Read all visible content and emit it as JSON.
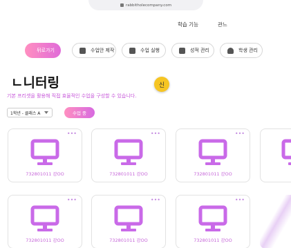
{
  "browser": {
    "url": "rabbitholecompany.com"
  },
  "topnav": {
    "items": [
      "학습 기능",
      "관느"
    ]
  },
  "toolbar": {
    "back_label": "뒤로가기",
    "buttons": [
      {
        "label": "수업안 제작",
        "icon": "document-icon"
      },
      {
        "label": "수업 실행",
        "icon": "play-icon"
      },
      {
        "label": "성적 관리",
        "icon": "chart-icon"
      },
      {
        "label": "학생 관리",
        "icon": "person-icon"
      }
    ]
  },
  "page": {
    "title": "ㄴ니터링",
    "badge": "신",
    "subtitle": "기본 프리셋을 활용해 직접 효율적인 수업을 구성할 수 있습니다."
  },
  "controls": {
    "class_select": "1학년 - 클래스 A",
    "start_button": "수업 중"
  },
  "cards": [
    {
      "label": "732801011 강OO"
    },
    {
      "label": "732801011 강OO"
    },
    {
      "label": "732801011 강OO"
    },
    {
      "label": ""
    },
    {
      "label": "732801011 강OO"
    },
    {
      "label": "732801011 강OO"
    },
    {
      "label": "732801011 강OO"
    }
  ],
  "colors": {
    "accent": "#c654d9",
    "monitor": "#c96ae8",
    "badge": "#f6c523"
  }
}
